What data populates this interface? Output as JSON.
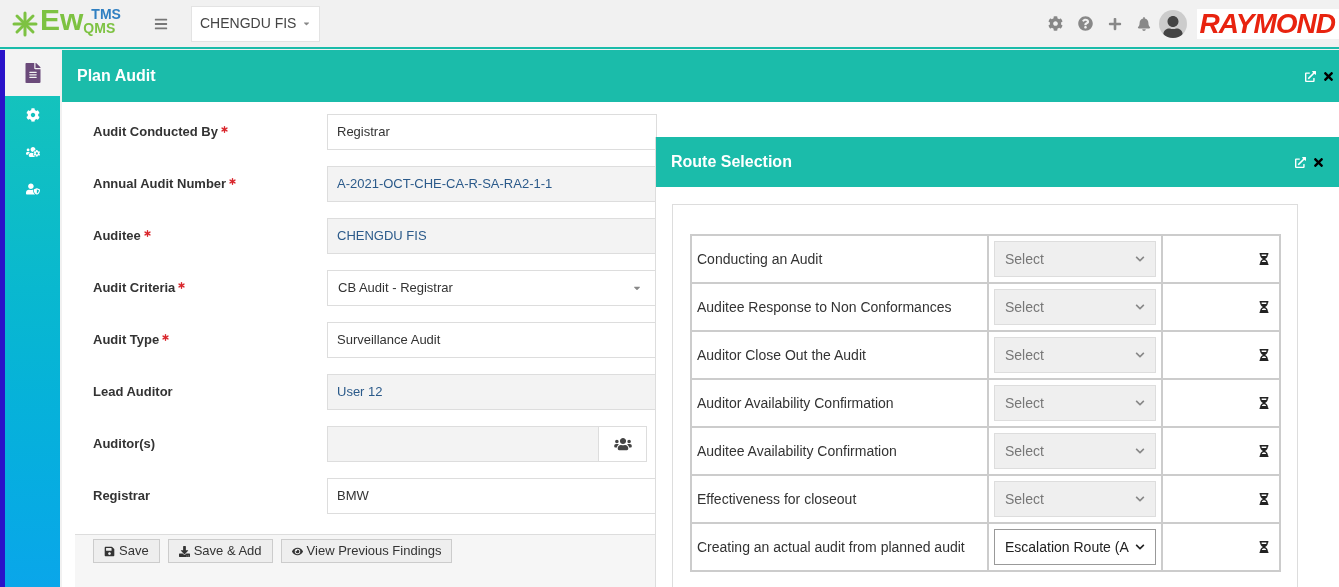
{
  "header": {
    "logo": {
      "top": "TMS",
      "main": "Ew",
      "sub": "QMS"
    },
    "site_selector": "CHENGDU FIS",
    "brand": "RAYMOND"
  },
  "sidebar": {
    "items": [
      {
        "kind": "document",
        "selected": true
      },
      {
        "kind": "settings",
        "selected": false
      },
      {
        "kind": "group",
        "selected": false
      },
      {
        "kind": "user-shield",
        "selected": false
      }
    ]
  },
  "plan_audit": {
    "title": "Plan Audit",
    "fields": [
      {
        "label": "Audit Conducted By",
        "required": true,
        "value": "Registrar",
        "kind": "text",
        "disabled": false
      },
      {
        "label": "Annual Audit Number",
        "required": true,
        "value": "A-2021-OCT-CHE-CA-R-SA-RA2-1-1",
        "kind": "text",
        "disabled": true
      },
      {
        "label": "Auditee",
        "required": true,
        "value": "CHENGDU FIS",
        "kind": "addon",
        "disabled": true
      },
      {
        "label": "Audit Criteria",
        "required": true,
        "value": "CB Audit - Registrar",
        "kind": "select",
        "disabled": false
      },
      {
        "label": "Audit Type",
        "required": true,
        "value": "Surveillance Audit",
        "kind": "text",
        "disabled": false
      },
      {
        "label": "Lead Auditor",
        "required": false,
        "value": "User 12",
        "kind": "addon",
        "disabled": true
      },
      {
        "label": "Auditor(s)",
        "required": false,
        "kind": "users",
        "disabled": true
      },
      {
        "label": "Registrar",
        "required": false,
        "value": "BMW",
        "kind": "text",
        "disabled": false
      }
    ],
    "buttons": [
      "Save",
      "Save & Add",
      "View Previous Findings"
    ]
  },
  "route_selection": {
    "title": "Route Selection",
    "rows": [
      {
        "step": "Conducting an Audit",
        "route": "Select",
        "disabled": true
      },
      {
        "step": "Auditee Response to Non Conformances",
        "route": "Select",
        "disabled": true
      },
      {
        "step": "Auditor Close Out the Audit",
        "route": "Select",
        "disabled": true
      },
      {
        "step": "Auditor Availability Confirmation",
        "route": "Select",
        "disabled": true
      },
      {
        "step": "Auditee Availability Confirmation",
        "route": "Select",
        "disabled": true
      },
      {
        "step": "Effectiveness for closeout",
        "route": "Select",
        "disabled": true
      },
      {
        "step": "Creating an actual audit from planned audit",
        "route": "Escalation Route (A",
        "disabled": false
      }
    ]
  }
}
